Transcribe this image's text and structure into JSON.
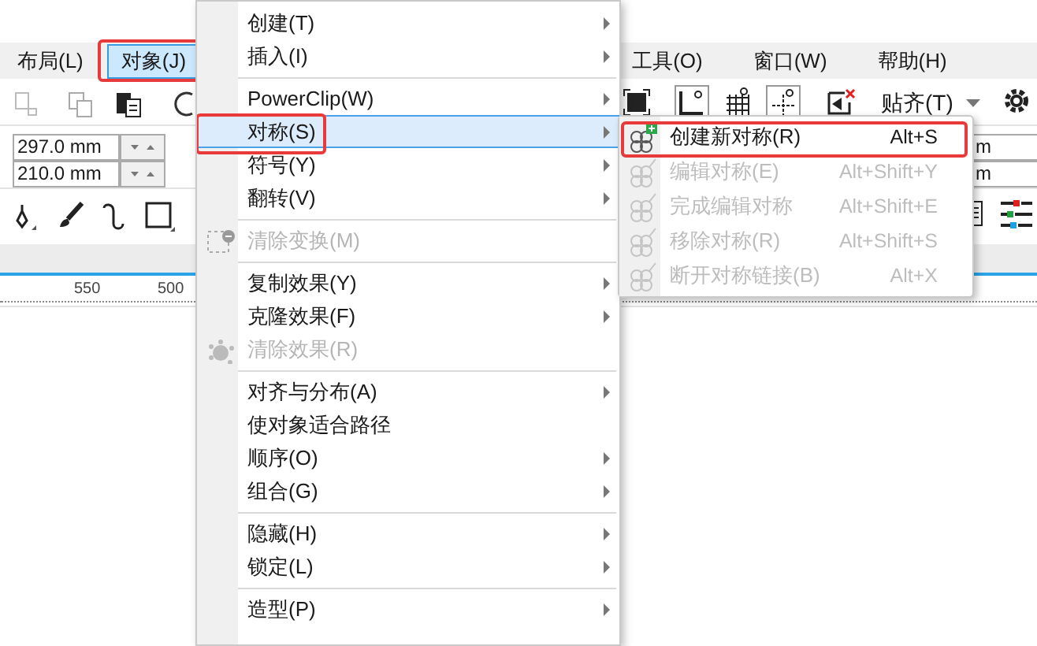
{
  "menubar": [
    {
      "label": "布局(L)",
      "selected": false,
      "annotated": false
    },
    {
      "label": "对象(J)",
      "selected": true,
      "annotated": true
    },
    {
      "label": "工具(O)",
      "selected": false,
      "annotated": false
    },
    {
      "label": "窗口(W)",
      "selected": false,
      "annotated": false
    },
    {
      "label": "帮助(H)",
      "selected": false,
      "annotated": false
    }
  ],
  "toolbar": {
    "snap_button": "贴齐(T)"
  },
  "property_bar": {
    "width": "297.0 mm",
    "height": "210.0 mm",
    "right_fields": [
      "m",
      "m"
    ]
  },
  "ruler": {
    "labels": [
      "550",
      "500"
    ]
  },
  "menu": {
    "items": [
      {
        "kind": "item",
        "label": "创建(T)",
        "submenu": true,
        "disabled": false,
        "selected": false,
        "annotated": false
      },
      {
        "kind": "item",
        "label": "插入(I)",
        "submenu": true,
        "disabled": false,
        "selected": false,
        "annotated": false
      },
      {
        "kind": "separator"
      },
      {
        "kind": "item",
        "label": "PowerClip(W)",
        "submenu": true,
        "disabled": false,
        "selected": false,
        "annotated": false
      },
      {
        "kind": "item",
        "label": "对称(S)",
        "submenu": true,
        "disabled": false,
        "selected": true,
        "annotated": true
      },
      {
        "kind": "item",
        "label": "符号(Y)",
        "submenu": true,
        "disabled": false,
        "selected": false,
        "annotated": false
      },
      {
        "kind": "item",
        "label": "翻转(V)",
        "submenu": true,
        "disabled": false,
        "selected": false,
        "annotated": false
      },
      {
        "kind": "separator"
      },
      {
        "kind": "item",
        "label": "清除变换(M)",
        "submenu": false,
        "disabled": true,
        "selected": false,
        "annotated": false
      },
      {
        "kind": "separator"
      },
      {
        "kind": "item",
        "label": "复制效果(Y)",
        "submenu": true,
        "disabled": false,
        "selected": false,
        "annotated": false
      },
      {
        "kind": "item",
        "label": "克隆效果(F)",
        "submenu": true,
        "disabled": false,
        "selected": false,
        "annotated": false
      },
      {
        "kind": "item",
        "label": "清除效果(R)",
        "submenu": false,
        "disabled": true,
        "selected": false,
        "annotated": false
      },
      {
        "kind": "separator"
      },
      {
        "kind": "item",
        "label": "对齐与分布(A)",
        "submenu": true,
        "disabled": false,
        "selected": false,
        "annotated": false
      },
      {
        "kind": "item",
        "label": "使对象适合路径",
        "submenu": false,
        "disabled": false,
        "selected": false,
        "annotated": false
      },
      {
        "kind": "item",
        "label": "顺序(O)",
        "submenu": true,
        "disabled": false,
        "selected": false,
        "annotated": false
      },
      {
        "kind": "item",
        "label": "组合(G)",
        "submenu": true,
        "disabled": false,
        "selected": false,
        "annotated": false
      },
      {
        "kind": "separator"
      },
      {
        "kind": "item",
        "label": "隐藏(H)",
        "submenu": true,
        "disabled": false,
        "selected": false,
        "annotated": false
      },
      {
        "kind": "item",
        "label": "锁定(L)",
        "submenu": true,
        "disabled": false,
        "selected": false,
        "annotated": false
      },
      {
        "kind": "separator"
      },
      {
        "kind": "item",
        "label": "造型(P)",
        "submenu": true,
        "disabled": false,
        "selected": false,
        "annotated": false
      }
    ]
  },
  "submenu": {
    "items": [
      {
        "label": "创建新对称(R)",
        "shortcut": "Alt+S",
        "disabled": false,
        "selected": false,
        "annotated": true
      },
      {
        "label": "编辑对称(E)",
        "shortcut": "Alt+Shift+Y",
        "disabled": true,
        "selected": false,
        "annotated": false
      },
      {
        "label": "完成编辑对称",
        "shortcut": "Alt+Shift+E",
        "disabled": true,
        "selected": false,
        "annotated": false
      },
      {
        "label": "移除对称(R)",
        "shortcut": "Alt+Shift+S",
        "disabled": true,
        "selected": false,
        "annotated": false
      },
      {
        "label": "断开对称链接(B)",
        "shortcut": "Alt+X",
        "disabled": true,
        "selected": false,
        "annotated": false
      }
    ]
  }
}
